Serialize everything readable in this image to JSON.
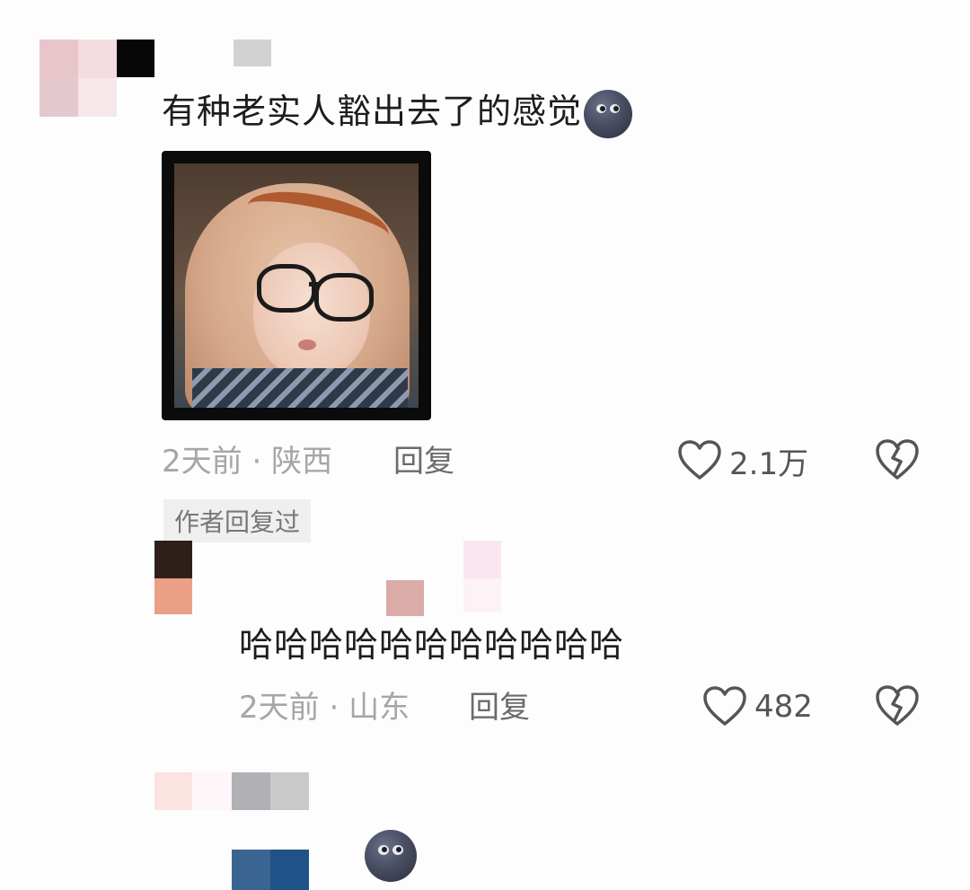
{
  "comment1": {
    "text": "有种老实人豁出去了的感觉",
    "emoji": "new-moon-face",
    "meta_time": "2天前",
    "meta_sep": "·",
    "meta_location": "陕西",
    "reply_label": "回复",
    "likes": "2.1万",
    "author_replied_badge": "作者回复过"
  },
  "comment2": {
    "text": "哈哈哈哈哈哈哈哈哈哈哈",
    "meta_time": "2天前",
    "meta_sep": "·",
    "meta_location": "山东",
    "reply_label": "回复",
    "likes": "482"
  },
  "comment3": {
    "emoji": "new-moon-face"
  },
  "icons": {
    "like": "heart-outline-icon",
    "dislike": "broken-heart-icon"
  },
  "colors": {
    "meta": "#a6a6a6",
    "reply": "#6b6b6b",
    "badge_bg": "#efefef"
  }
}
